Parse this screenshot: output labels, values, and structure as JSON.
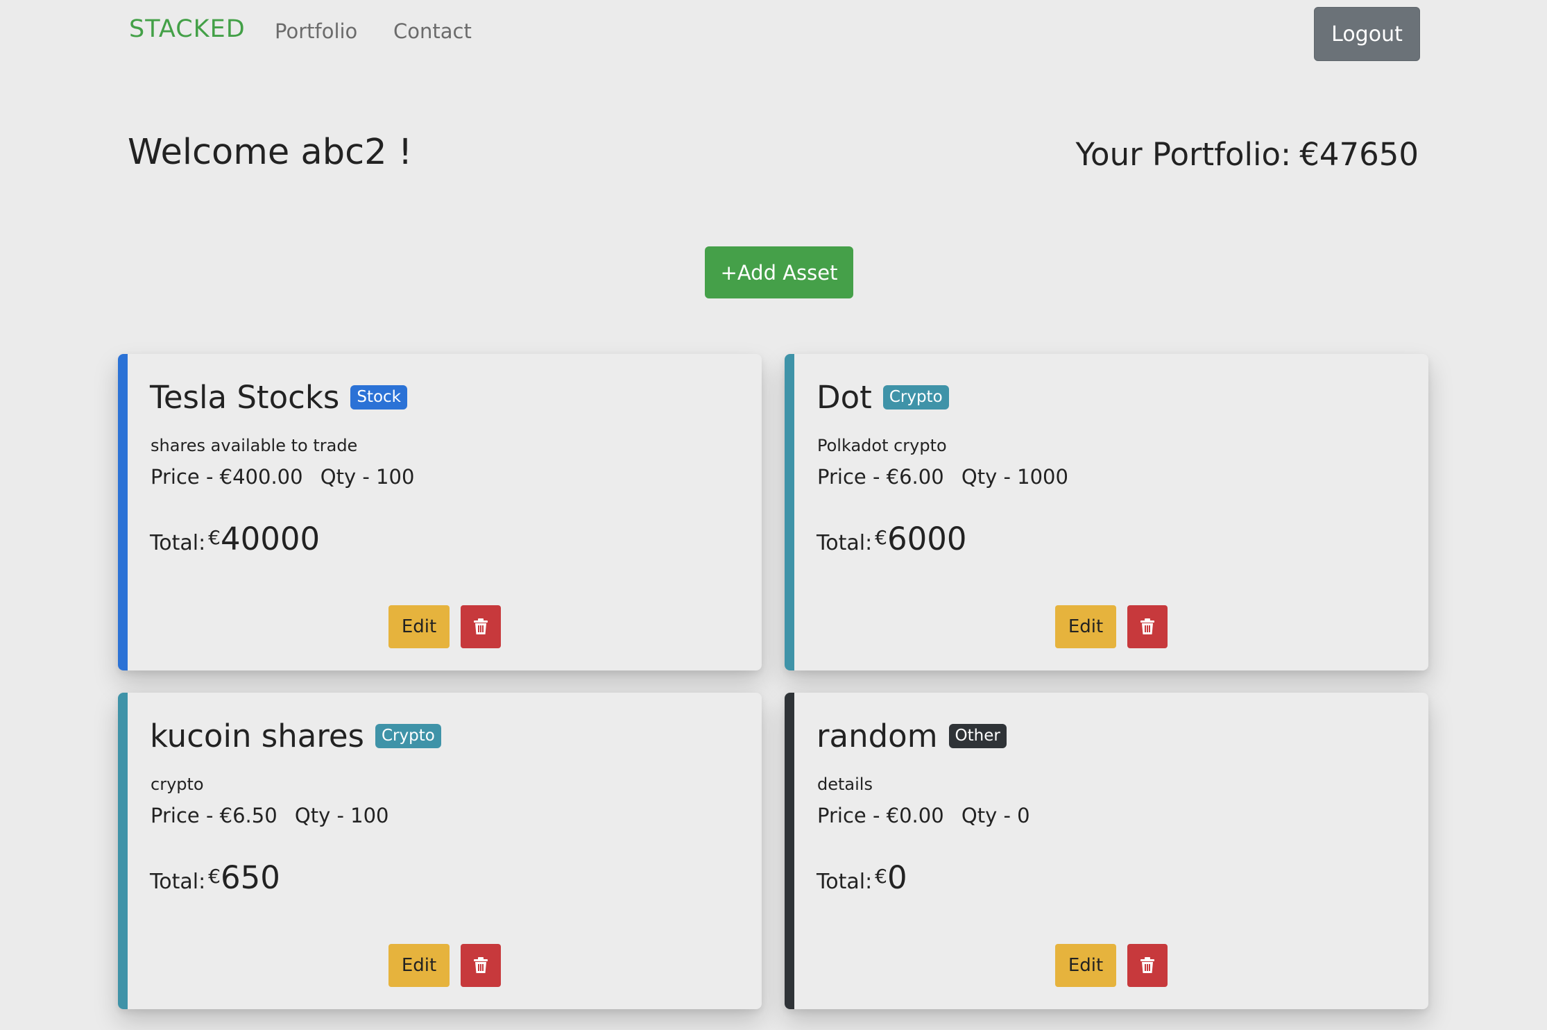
{
  "nav": {
    "brand": "STACKED",
    "links": [
      "Portfolio",
      "Contact"
    ],
    "logout_label": "Logout"
  },
  "header": {
    "welcome": "Welcome abc2 !",
    "portfolio_label": "Your Portfolio:",
    "portfolio_value": "€47650"
  },
  "add_asset_label": "+Add Asset",
  "edit_label": "Edit",
  "delete_icon": "trash-icon",
  "colors": {
    "brand": "#43a047",
    "stock": "#2b72d6",
    "crypto": "#3f93a8",
    "other": "#2f3337",
    "edit": "#e6b33d",
    "delete": "#c7393c"
  },
  "assets": [
    {
      "name": "Tesla Stocks",
      "type": "Stock",
      "description": "shares available to trade",
      "price": "Price - €400.00",
      "qty": "Qty - 100",
      "total_label": "Total:",
      "currency": "€",
      "total": "40000"
    },
    {
      "name": "Dot",
      "type": "Crypto",
      "description": "Polkadot crypto",
      "price": "Price - €6.00",
      "qty": "Qty - 1000",
      "total_label": "Total:",
      "currency": "€",
      "total": "6000"
    },
    {
      "name": "kucoin shares",
      "type": "Crypto",
      "description": "crypto",
      "price": "Price - €6.50",
      "qty": "Qty - 100",
      "total_label": "Total:",
      "currency": "€",
      "total": "650"
    },
    {
      "name": "random",
      "type": "Other",
      "description": "details",
      "price": "Price - €0.00",
      "qty": "Qty - 0",
      "total_label": "Total:",
      "currency": "€",
      "total": "0"
    }
  ]
}
